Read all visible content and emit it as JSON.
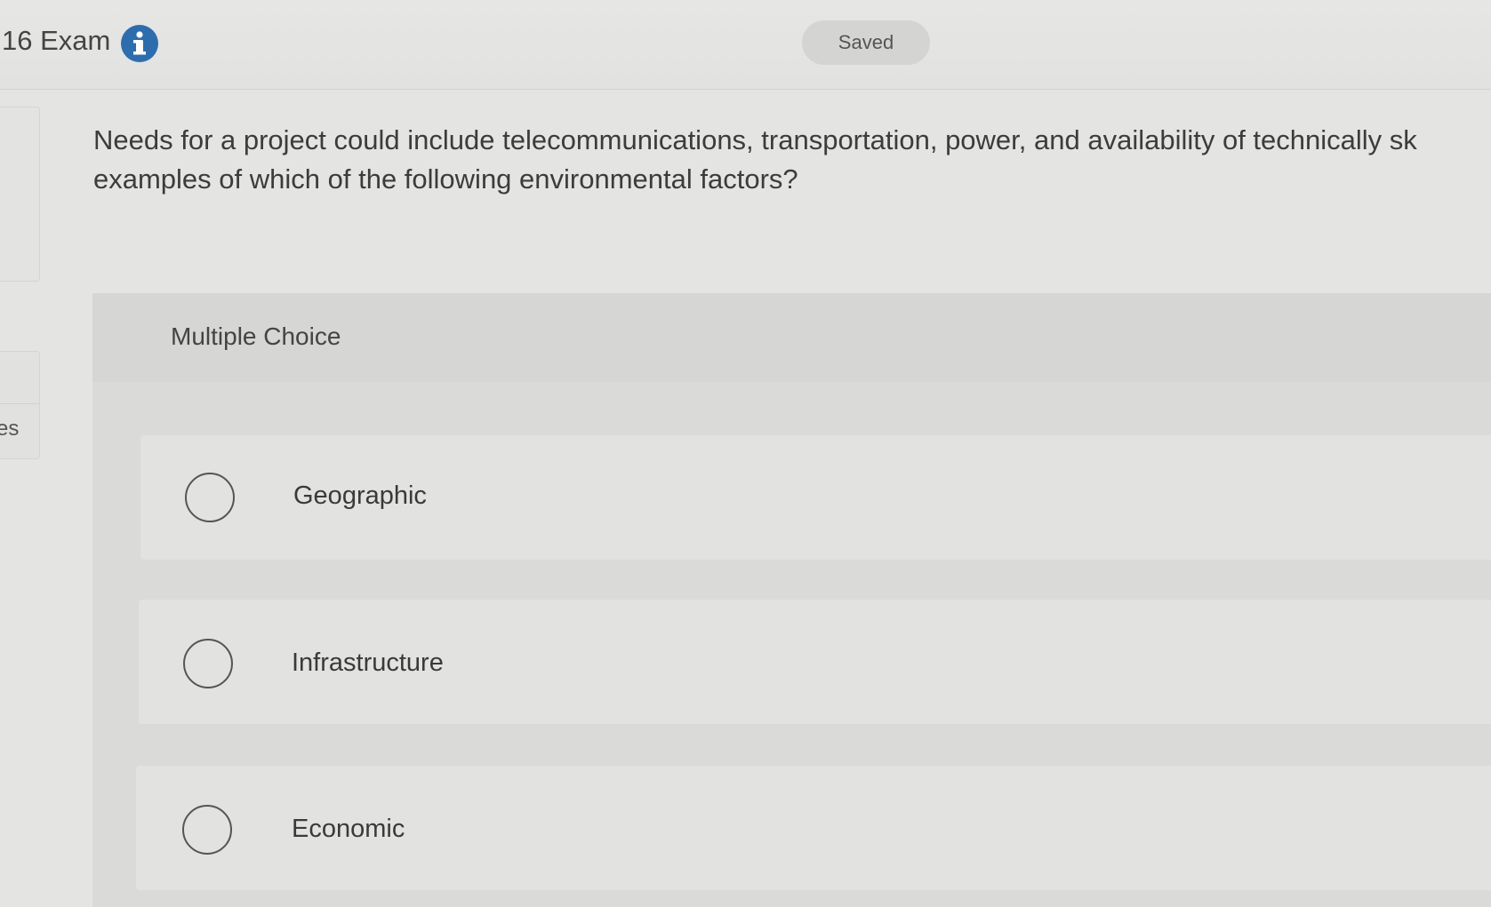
{
  "header": {
    "exam_title": "16 Exam",
    "info_icon": "info-icon",
    "status": "Saved"
  },
  "sidebar": {
    "partial_text": "es"
  },
  "question": {
    "line1": "Needs for a project could include telecommunications, transportation, power, and availability of technically sk",
    "line2": "examples of which of the following environmental factors?"
  },
  "answer_panel": {
    "type_label": "Multiple Choice",
    "options": [
      {
        "label": "Geographic",
        "selected": false
      },
      {
        "label": "Infrastructure",
        "selected": false
      },
      {
        "label": "Economic",
        "selected": false
      }
    ]
  },
  "colors": {
    "info_icon": "#2d6dad",
    "background": "#e4e4e2",
    "panel": "#dadad8"
  }
}
